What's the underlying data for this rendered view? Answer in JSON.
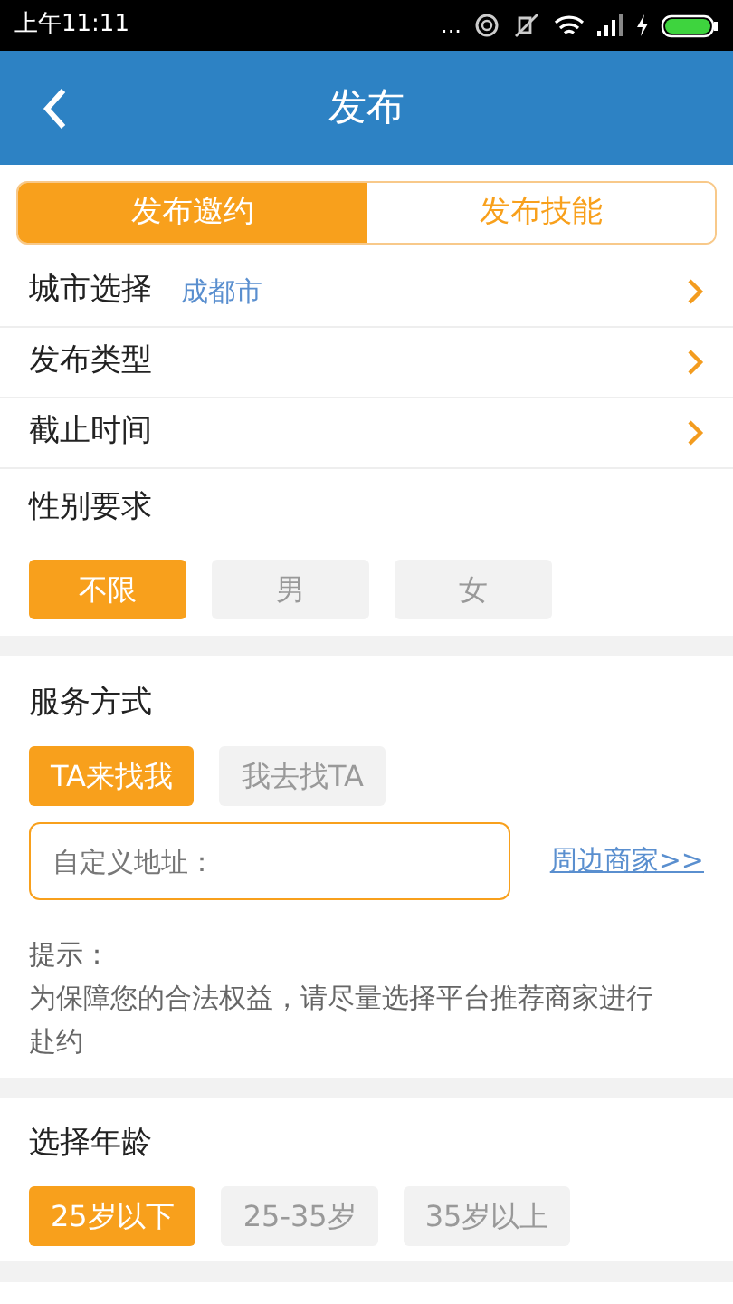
{
  "status_bar": {
    "time": "上午11:11",
    "dots": "..."
  },
  "header": {
    "title": "发布"
  },
  "tabs": [
    {
      "label": "发布邀约",
      "selected": true
    },
    {
      "label": "发布技能",
      "selected": false
    }
  ],
  "rows": [
    {
      "label": "城市选择",
      "value": "成都市"
    },
    {
      "label": "发布类型"
    },
    {
      "label": "截止时间"
    }
  ],
  "gender": {
    "title": "性别要求",
    "options": [
      {
        "label": "不限",
        "selected": true
      },
      {
        "label": "男",
        "selected": false
      },
      {
        "label": "女",
        "selected": false
      }
    ]
  },
  "service": {
    "title": "服务方式",
    "options": [
      {
        "label": "TA来找我",
        "selected": true
      },
      {
        "label": "我去找TA",
        "selected": false
      }
    ],
    "address_placeholder": "自定义地址：",
    "link": "周边商家>>",
    "hint_title": "提示：",
    "hint": "为保障您的合法权益，请尽量选择平台推荐商家进行赴约"
  },
  "age": {
    "title": "选择年龄",
    "options": [
      {
        "label": "25岁以下",
        "selected": true
      },
      {
        "label": "25-35岁",
        "selected": false
      },
      {
        "label": "35岁以上",
        "selected": false
      }
    ]
  }
}
